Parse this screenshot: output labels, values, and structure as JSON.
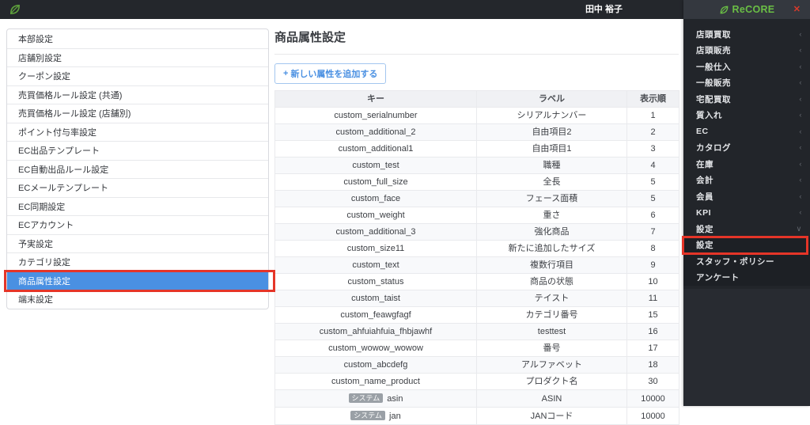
{
  "topbar": {
    "user_name": "田中 裕子"
  },
  "brand": {
    "name": "ReCORE",
    "close_glyph": "✕",
    "leaf_icon": "leaf-icon"
  },
  "colors": {
    "accent_blue": "#4a90e2",
    "annotation_red": "#e53528",
    "brand_green": "#6abe45",
    "badge_gray": "#9aa0a6",
    "topbar_bg": "#24272c",
    "sidebar_bg": "#22252a"
  },
  "left_nav": {
    "items": [
      {
        "label": "本部設定"
      },
      {
        "label": "店舗別設定"
      },
      {
        "label": "クーポン設定"
      },
      {
        "label": "売買価格ルール設定 (共通)"
      },
      {
        "label": "売買価格ルール設定 (店舗別)"
      },
      {
        "label": "ポイント付与率設定"
      },
      {
        "label": "EC出品テンプレート"
      },
      {
        "label": "EC自動出品ルール設定"
      },
      {
        "label": "ECメールテンプレート"
      },
      {
        "label": "EC同期設定"
      },
      {
        "label": "ECアカウント"
      },
      {
        "label": "予実設定"
      },
      {
        "label": "カテゴリ設定"
      },
      {
        "label": "商品属性設定",
        "selected": true,
        "annotated": true
      },
      {
        "label": "端末設定"
      }
    ]
  },
  "main": {
    "title": "商品属性設定",
    "add_button": {
      "icon": "+",
      "label": "新しい属性を追加する"
    },
    "table": {
      "columns": [
        "キー",
        "ラベル",
        "表示順"
      ],
      "rows": [
        {
          "key": "custom_serialnumber",
          "label": "シリアルナンバー",
          "order": "1"
        },
        {
          "key": "custom_additional_2",
          "label": "自由項目2",
          "order": "2"
        },
        {
          "key": "custom_additional1",
          "label": "自由項目1",
          "order": "3"
        },
        {
          "key": "custom_test",
          "label": "職種",
          "order": "4"
        },
        {
          "key": "custom_full_size",
          "label": "全長",
          "order": "5"
        },
        {
          "key": "custom_face",
          "label": "フェース面積",
          "order": "5"
        },
        {
          "key": "custom_weight",
          "label": "重さ",
          "order": "6"
        },
        {
          "key": "custom_additional_3",
          "label": "強化商品",
          "order": "7"
        },
        {
          "key": "custom_size11",
          "label": "新たに追加したサイズ",
          "order": "8"
        },
        {
          "key": "custom_text",
          "label": "複数行項目",
          "order": "9"
        },
        {
          "key": "custom_status",
          "label": "商品の状態",
          "order": "10"
        },
        {
          "key": "custom_taist",
          "label": "テイスト",
          "order": "11"
        },
        {
          "key": "custom_feawgfagf",
          "label": "カテゴリ番号",
          "order": "15"
        },
        {
          "key": "custom_ahfuiahfuia_fhbjawhf",
          "label": "testtest",
          "order": "16"
        },
        {
          "key": "custom_wowow_wowow",
          "label": "番号",
          "order": "17"
        },
        {
          "key": "custom_abcdefg",
          "label": "アルファベット",
          "order": "18"
        },
        {
          "key": "custom_name_product",
          "label": "プロダクト名",
          "order": "30"
        },
        {
          "key": "asin",
          "badge": "システム",
          "label": "ASIN",
          "order": "10000"
        },
        {
          "key": "jan",
          "badge": "システム",
          "label": "JANコード",
          "order": "10000"
        }
      ]
    }
  },
  "right_nav": {
    "items": [
      {
        "label": "店頭買取",
        "chevron": "‹"
      },
      {
        "label": "店頭販売",
        "chevron": "‹"
      },
      {
        "label": "一般仕入",
        "chevron": "‹"
      },
      {
        "label": "一般販売",
        "chevron": "‹"
      },
      {
        "label": "宅配買取",
        "chevron": "‹"
      },
      {
        "label": "質入れ",
        "chevron": "‹"
      },
      {
        "label": "EC",
        "chevron": "‹"
      },
      {
        "label": "カタログ",
        "chevron": "‹"
      },
      {
        "label": "在庫",
        "chevron": "‹"
      },
      {
        "label": "会計",
        "chevron": "‹"
      },
      {
        "label": "会員",
        "chevron": "‹"
      },
      {
        "label": "KPI",
        "chevron": "‹"
      },
      {
        "label": "設定",
        "chevron": "∨"
      },
      {
        "label": "設定",
        "sub": true,
        "annotated": true
      },
      {
        "label": "スタッフ・ポリシー",
        "sub": true
      },
      {
        "label": "アンケート",
        "sub": true
      }
    ]
  }
}
